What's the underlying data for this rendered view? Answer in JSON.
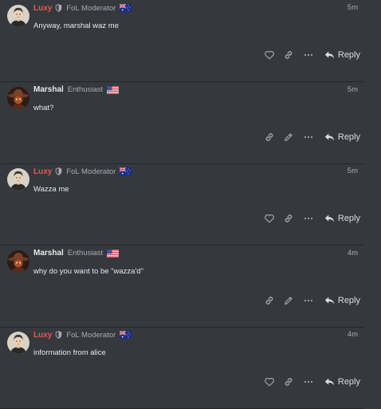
{
  "colors": {
    "background": "#35393e",
    "moderator_name": "#e5584f",
    "muted_text": "#a8acb0",
    "divider": "#23262a"
  },
  "icons": {
    "like": "heart-icon",
    "link": "link-icon",
    "edit": "pencil-icon",
    "more": "ellipsis-icon",
    "reply": "reply-arrow-icon",
    "moderator": "shield-icon"
  },
  "posts": [
    {
      "username": "Luxy",
      "user_title": "FoL Moderator",
      "flag": "australia-flag",
      "age": "5m",
      "body": "Anyway, marshal waz me",
      "actions": [
        "like",
        "link",
        "more"
      ],
      "reply_label": "Reply"
    },
    {
      "username": "Marshal",
      "user_title": "Enthusiast",
      "flag": "usa-flag",
      "age": "5m",
      "body": "what?",
      "actions": [
        "link",
        "edit",
        "more"
      ],
      "reply_label": "Reply"
    },
    {
      "username": "Luxy",
      "user_title": "FoL Moderator",
      "flag": "australia-flag",
      "age": "5m",
      "body": "Wazza me",
      "actions": [
        "like",
        "link",
        "more"
      ],
      "reply_label": "Reply"
    },
    {
      "username": "Marshal",
      "user_title": "Enthusiast",
      "flag": "usa-flag",
      "age": "4m",
      "body": "why do you want to be \"wazza'd\"",
      "actions": [
        "link",
        "edit",
        "more"
      ],
      "reply_label": "Reply"
    },
    {
      "username": "Luxy",
      "user_title": "FoL Moderator",
      "flag": "australia-flag",
      "age": "4m",
      "body": "information from alice",
      "actions": [
        "like",
        "link",
        "more"
      ],
      "reply_label": "Reply"
    }
  ]
}
